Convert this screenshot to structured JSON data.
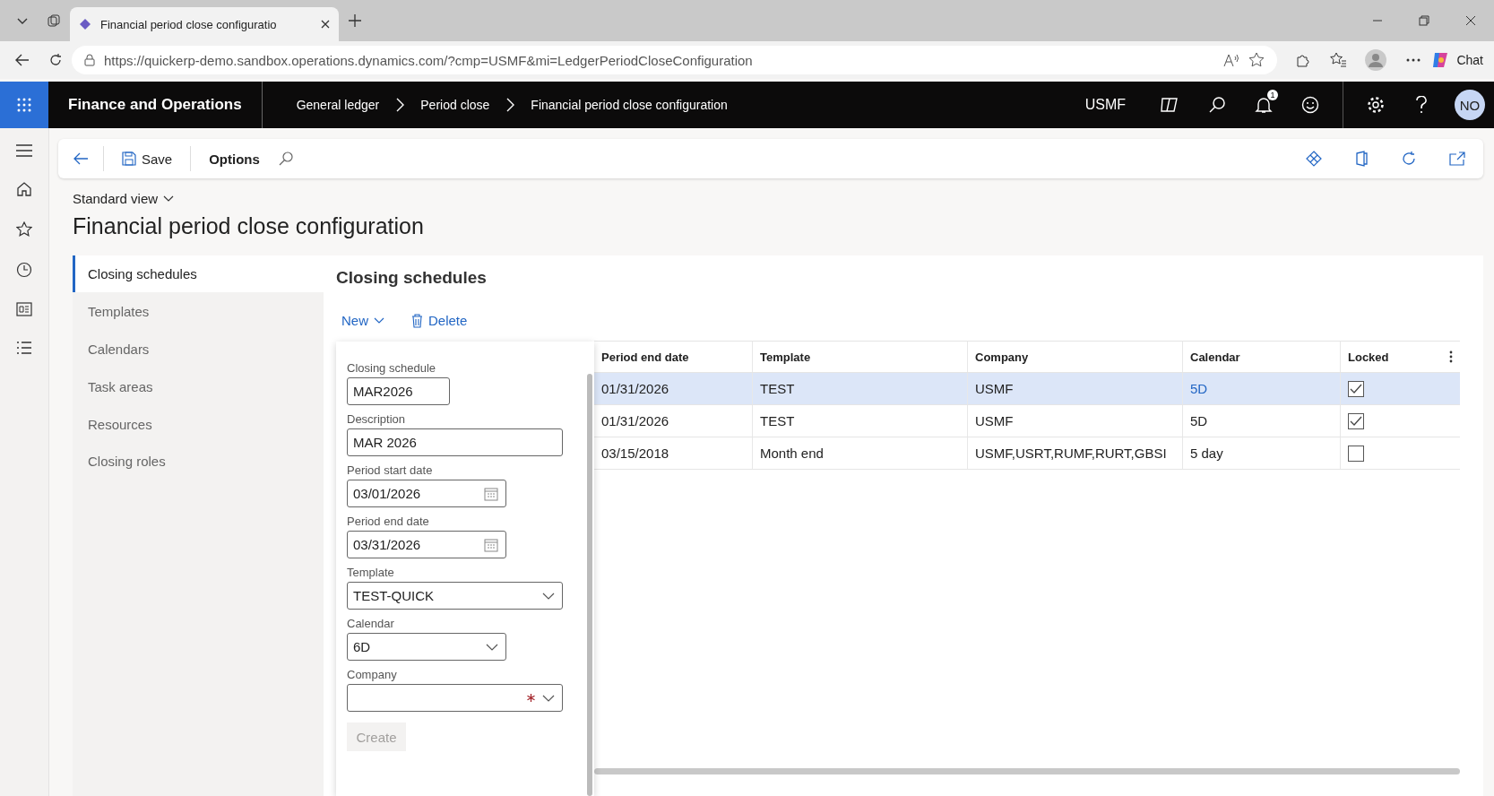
{
  "browser": {
    "tab_title": "Financial period close configuratio",
    "url": "https://quickerp-demo.sandbox.operations.dynamics.com/?cmp=USMF&mi=LedgerPeriodCloseConfiguration",
    "chat": "Chat"
  },
  "header": {
    "app": "Finance and Operations",
    "breadcrumbs": [
      "General ledger",
      "Period close",
      "Financial period close configuration"
    ],
    "company": "USMF",
    "notifications": "1",
    "avatar": "NO"
  },
  "toolbar": {
    "save": "Save",
    "options": "Options"
  },
  "view": "Standard view",
  "title": "Financial period close configuration",
  "nav": [
    {
      "label": "Closing schedules",
      "selected": true
    },
    {
      "label": "Templates",
      "selected": false
    },
    {
      "label": "Calendars",
      "selected": false
    },
    {
      "label": "Task areas",
      "selected": false
    },
    {
      "label": "Resources",
      "selected": false
    },
    {
      "label": "Closing roles",
      "selected": false
    }
  ],
  "section_title": "Closing schedules",
  "actions": {
    "new": "New",
    "delete": "Delete"
  },
  "grid": {
    "columns": [
      "Period end date",
      "Template",
      "Company",
      "Calendar",
      "Locked"
    ],
    "rows": [
      {
        "cells": [
          "01/31/2026",
          "TEST",
          "USMF",
          "5D"
        ],
        "locked": true,
        "selected": true
      },
      {
        "cells": [
          "01/31/2026",
          "TEST",
          "USMF",
          "5D"
        ],
        "locked": true,
        "selected": false
      },
      {
        "cells": [
          "03/15/2018",
          "Month end",
          "USMF,USRT,RUMF,RURT,GBSI",
          "5 day"
        ],
        "locked": false,
        "selected": false
      }
    ]
  },
  "flyout": {
    "fields": [
      {
        "label": "Closing schedule",
        "value": "MAR2026",
        "kind": "text"
      },
      {
        "label": "Description",
        "value": "MAR 2026",
        "kind": "text"
      },
      {
        "label": "Period start date",
        "value": "03/01/2026",
        "kind": "date"
      },
      {
        "label": "Period end date",
        "value": "03/31/2026",
        "kind": "date"
      },
      {
        "label": "Template",
        "value": "TEST-QUICK",
        "kind": "select"
      },
      {
        "label": "Calendar",
        "value": "6D",
        "kind": "select"
      },
      {
        "label": "Company",
        "kind": "select",
        "required": true
      }
    ],
    "create": {
      "label": "Create",
      "disabled": true
    }
  }
}
